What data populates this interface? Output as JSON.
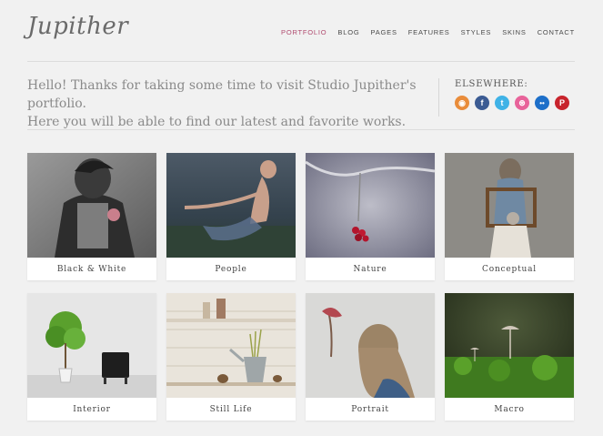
{
  "brand": {
    "logo_text": "Jupither"
  },
  "nav": {
    "items": [
      {
        "label": "PORTFOLIO",
        "active": true
      },
      {
        "label": "BLOG"
      },
      {
        "label": "PAGES"
      },
      {
        "label": "FEATURES"
      },
      {
        "label": "STYLES"
      },
      {
        "label": "SKINS"
      },
      {
        "label": "CONTACT"
      }
    ]
  },
  "intro": {
    "line1": "Hello! Thanks for taking some time to visit Studio Jupither's portfolio.",
    "line2": "Here you will be able to find our latest and favorite works."
  },
  "elsewhere": {
    "title": "ELSEWHERE:",
    "icons": [
      {
        "name": "rss-icon",
        "glyph": "◉",
        "color": "#e98c3a"
      },
      {
        "name": "facebook-icon",
        "glyph": "f",
        "color": "#3b5b93"
      },
      {
        "name": "twitter-icon",
        "glyph": "t",
        "color": "#3fb2e6"
      },
      {
        "name": "dribbble-icon",
        "glyph": "⊛",
        "color": "#e8639a"
      },
      {
        "name": "flickr-icon",
        "glyph": "••",
        "color": "#1d6fc9"
      },
      {
        "name": "pinterest-icon",
        "glyph": "P",
        "color": "#c8232c"
      }
    ]
  },
  "portfolio": {
    "items": [
      {
        "label": "Black & White"
      },
      {
        "label": "People"
      },
      {
        "label": "Nature"
      },
      {
        "label": "Conceptual"
      },
      {
        "label": "Interior"
      },
      {
        "label": "Still Life"
      },
      {
        "label": "Portrait"
      },
      {
        "label": "Macro"
      }
    ]
  }
}
